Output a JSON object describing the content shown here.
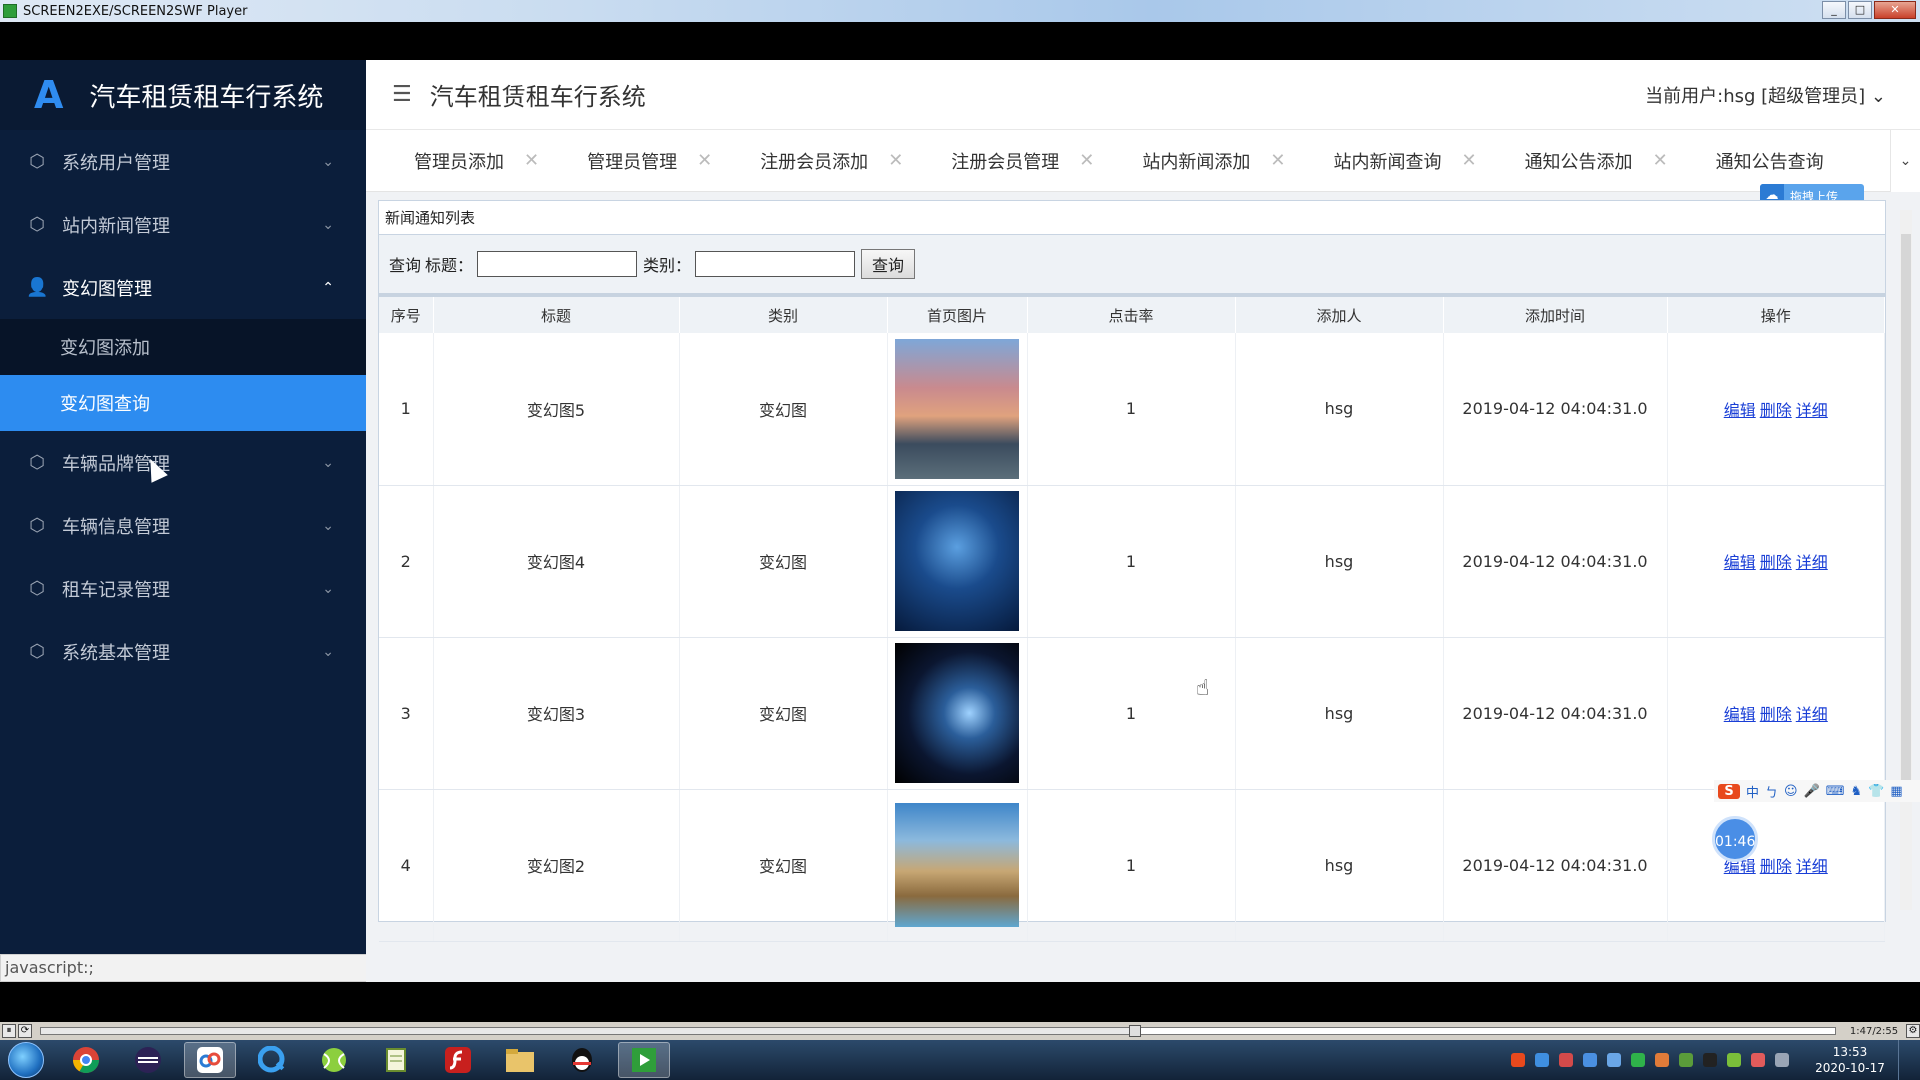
{
  "window": {
    "title": "SCREEN2EXE/SCREEN2SWF Player",
    "minimize": "_",
    "maximize": "□",
    "close": "✕"
  },
  "sidebar": {
    "brand_logo": "A",
    "brand_title": "汽车租赁租车行系统",
    "items": [
      {
        "label": "系统用户管理",
        "icon": "⬡",
        "chevron": "⌄"
      },
      {
        "label": "站内新闻管理",
        "icon": "⬡",
        "chevron": "⌄"
      },
      {
        "label": "变幻图管理",
        "icon": "👤",
        "chevron": "⌃"
      },
      {
        "label": "车辆品牌管理",
        "icon": "⬡",
        "chevron": "⌄"
      },
      {
        "label": "车辆信息管理",
        "icon": "⬡",
        "chevron": "⌄"
      },
      {
        "label": "租车记录管理",
        "icon": "⬡",
        "chevron": "⌄"
      },
      {
        "label": "系统基本管理",
        "icon": "⬡",
        "chevron": "⌄"
      }
    ],
    "submenu": [
      {
        "label": "变幻图添加"
      },
      {
        "label": "变幻图查询"
      }
    ]
  },
  "statusbar": {
    "url": "javascript:;"
  },
  "header": {
    "hamburger": "☰",
    "title": "汽车租赁租车行系统",
    "current_user": "当前用户:hsg [超级管理员] ⌄"
  },
  "tabs": [
    {
      "label": "管理员添加"
    },
    {
      "label": "管理员管理"
    },
    {
      "label": "注册会员添加"
    },
    {
      "label": "注册会员管理"
    },
    {
      "label": "站内新闻添加"
    },
    {
      "label": "站内新闻查询"
    },
    {
      "label": "通知公告添加"
    },
    {
      "label": "通知公告查询"
    }
  ],
  "tab_close": "✕",
  "tab_more": "⌄",
  "upload_badge": {
    "icon": "☁",
    "label": "拖拽上传"
  },
  "panel": {
    "title": "新闻通知列表",
    "search": {
      "prefix": "查询",
      "title_label": "标题：",
      "title_value": "",
      "category_label": "类别：",
      "category_value": "",
      "button": "查询"
    },
    "columns": [
      "序号",
      "标题",
      "类别",
      "首页图片",
      "点击率",
      "添加人",
      "添加时间",
      "操作"
    ],
    "rows": [
      {
        "no": "1",
        "title": "变幻图5",
        "category": "变幻图",
        "clicks": "1",
        "adder": "hsg",
        "time": "2019-04-12 04:04:31.0"
      },
      {
        "no": "2",
        "title": "变幻图4",
        "category": "变幻图",
        "clicks": "1",
        "adder": "hsg",
        "time": "2019-04-12 04:04:31.0"
      },
      {
        "no": "3",
        "title": "变幻图3",
        "category": "变幻图",
        "clicks": "1",
        "adder": "hsg",
        "time": "2019-04-12 04:04:31.0"
      },
      {
        "no": "4",
        "title": "变幻图2",
        "category": "变幻图",
        "clicks": "1",
        "adder": "hsg",
        "time": "2019-04-12 04:04:31.0"
      }
    ],
    "actions": {
      "edit": "编辑",
      "delete": "删除",
      "detail": "详细"
    }
  },
  "ime": {
    "logo": "S",
    "items": [
      "中",
      "ㄅ",
      "☺",
      "🎤",
      "⌨",
      "♞",
      "👕",
      "▦"
    ]
  },
  "timer": "01:46",
  "player": {
    "pause": "⏸",
    "loop": "⟳",
    "position": "1:47/2:55",
    "settings": "⚙",
    "progress_fraction": 0.61
  },
  "taskbar": {
    "icons": [
      "chrome-icon",
      "eclipse-icon",
      "baidu-netdisk-icon",
      "q-browser-icon",
      "tennis-icon",
      "notepad-icon",
      "flash-icon",
      "explorer-icon",
      "qq-icon",
      "video-player-icon"
    ],
    "clock_time": "13:53",
    "clock_date": "2020-10-17"
  },
  "colors": {
    "sidebar_bg": "#0b1e3b",
    "active_item": "#2d8cf0",
    "link": "#1a3fd6"
  }
}
